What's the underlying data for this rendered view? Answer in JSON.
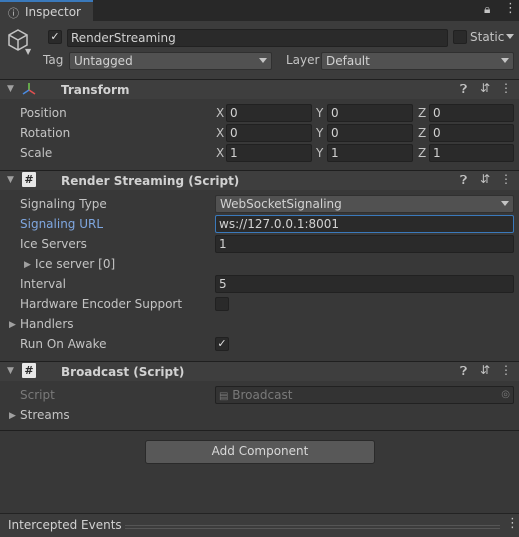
{
  "tab": {
    "label": "Inspector",
    "icon": "info-icon"
  },
  "window": {
    "lock_icon": "lock-icon",
    "menu_icon": "kebab-menu-icon"
  },
  "gameobject": {
    "name": "RenderStreaming",
    "active": true,
    "static_label": "Static",
    "static": false,
    "tag_label": "Tag",
    "tag_value": "Untagged",
    "layer_label": "Layer",
    "layer_value": "Default"
  },
  "transform": {
    "title": "Transform",
    "rows": [
      {
        "label": "Position",
        "x": "0",
        "y": "0",
        "z": "0"
      },
      {
        "label": "Rotation",
        "x": "0",
        "y": "0",
        "z": "0"
      },
      {
        "label": "Scale",
        "x": "1",
        "y": "1",
        "z": "1"
      }
    ],
    "axis": {
      "x": "X",
      "y": "Y",
      "z": "Z"
    }
  },
  "render_streaming": {
    "title": "Render Streaming (Script)",
    "signaling_type_label": "Signaling Type",
    "signaling_type_value": "WebSocketSignaling",
    "signaling_url_label": "Signaling URL",
    "signaling_url_value": "ws://127.0.0.1:8001",
    "ice_servers_label": "Ice Servers",
    "ice_servers_value": "1",
    "ice_server_item": "Ice server [0]",
    "interval_label": "Interval",
    "interval_value": "5",
    "hw_encoder_label": "Hardware Encoder Support",
    "hw_encoder": false,
    "handlers_label": "Handlers",
    "run_on_awake_label": "Run On Awake",
    "run_on_awake": true
  },
  "broadcast": {
    "title": "Broadcast (Script)",
    "script_label": "Script",
    "script_value": "Broadcast",
    "streams_label": "Streams"
  },
  "add_component_label": "Add Component",
  "footer": {
    "title": "Intercepted Events"
  },
  "colors": {
    "accent": "#3a79bb",
    "link": "#7fa7e0",
    "background": "#383838"
  }
}
